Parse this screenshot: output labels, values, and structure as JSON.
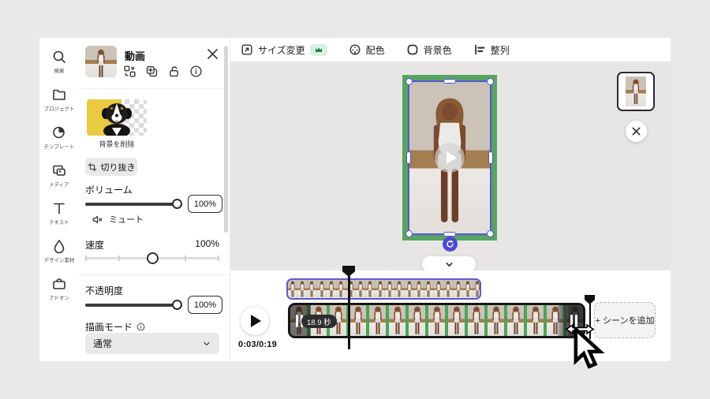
{
  "sidebar": {
    "items": [
      {
        "label": "検索",
        "icon": "search-icon"
      },
      {
        "label": "プロジェクト",
        "icon": "folder-icon"
      },
      {
        "label": "テンプレート",
        "icon": "template-icon"
      },
      {
        "label": "メディア",
        "icon": "media-icon"
      },
      {
        "label": "テキスト",
        "icon": "text-icon"
      },
      {
        "label": "デザイン素材",
        "icon": "shapes-icon"
      },
      {
        "label": "アドオン",
        "icon": "addons-icon"
      }
    ]
  },
  "panel": {
    "title": "動画",
    "remove_bg": "背景を削除",
    "crop": "切り抜き",
    "volume": {
      "label": "ボリューム",
      "value": "100%"
    },
    "mute": "ミュート",
    "speed": {
      "label": "速度",
      "value": "100%"
    },
    "opacity": {
      "label": "不透明度",
      "value": "100%"
    },
    "blend": {
      "label": "描画モード",
      "value": "通常"
    }
  },
  "toolbar": {
    "resize": "サイズ変更",
    "palette": "配色",
    "bg": "背景色",
    "align": "整列"
  },
  "timeline": {
    "time": "0:03/0:19",
    "badge": "18.9 秒",
    "add_scene": "+ シーンを追加",
    "track1_frames": 20,
    "track2_frames": 16
  },
  "icons": {
    "search-icon": "magnifier",
    "folder-icon": "folder",
    "template-icon": "template",
    "media-icon": "photos",
    "text-icon": "T",
    "shapes-icon": "droplet",
    "addons-icon": "box",
    "replace-icon": "swap-squares",
    "duplicate-icon": "copy-plus",
    "unlock-icon": "open-padlock",
    "info-icon": "circle-i",
    "close-icon": "x",
    "crop-icon": "crop-corners",
    "mute-icon": "speaker-x",
    "crown-icon": "crown",
    "palette-icon": "color-wheel",
    "bg-color-icon": "rounded-square",
    "align-icon": "align-bars",
    "resize-icon": "frame-arrow",
    "chevron-down-icon": "v",
    "rotate-icon": "circular-arrow",
    "play-icon": "triangle",
    "resize-horizontal-cursor": "double-arrow",
    "pointer-cursor": "arrow"
  },
  "colors": {
    "accent_purple": "#5456d6",
    "scene_green": "#57a561",
    "crown_badge_bg": "#d9f2e3",
    "badge_bg": "#2e2e2e"
  }
}
